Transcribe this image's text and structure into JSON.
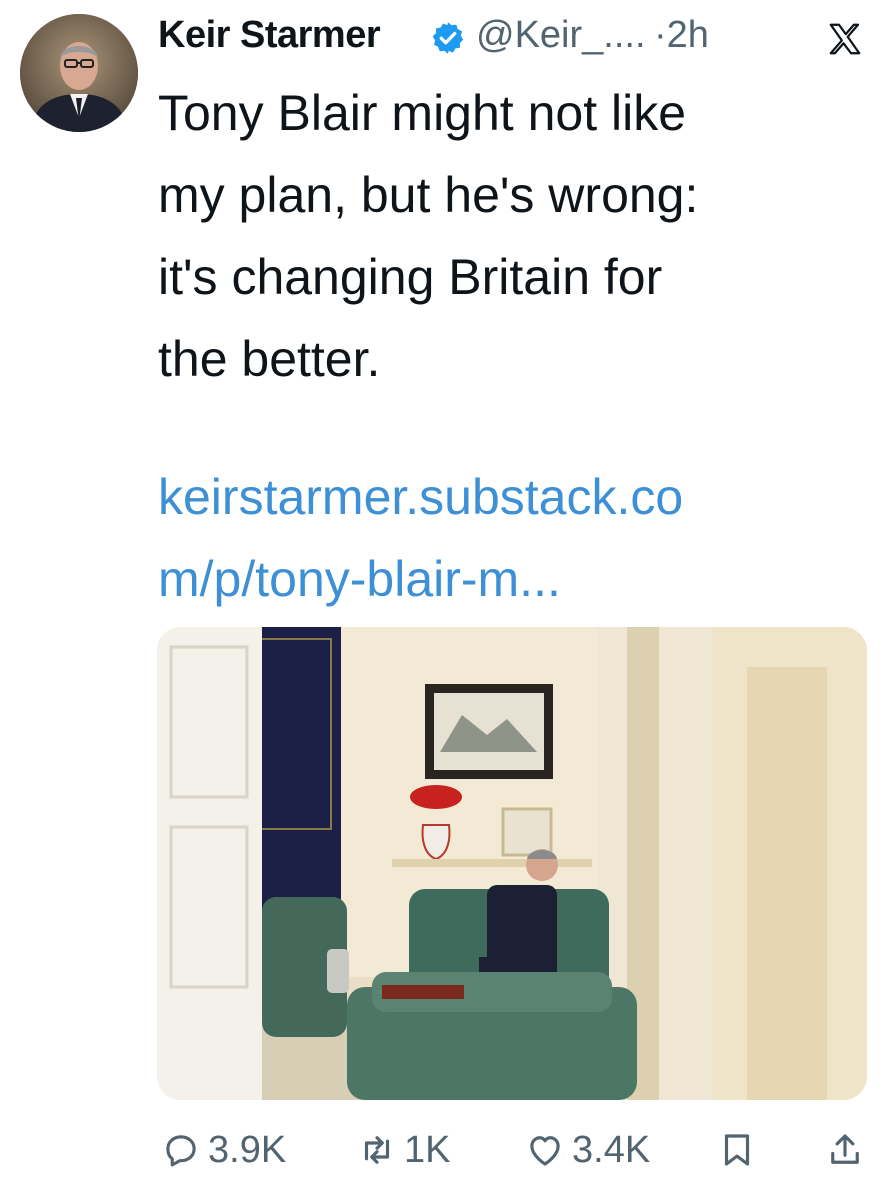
{
  "tweet": {
    "author_name": "Keir Starmer",
    "handle": "@Keir_....",
    "separator_time": "·2h",
    "body": "Tony Blair might not like\nmy plan, but he's wrong:\nit's changing Britain for\nthe better.",
    "link": "keirstarmer.substack.co\nm/p/tony-blair-m..."
  },
  "icons": {
    "verified": "verified-badge-icon",
    "platform": "x-logo-icon",
    "reply": "reply-icon",
    "repost": "repost-icon",
    "like": "heart-icon",
    "bookmark": "bookmark-icon",
    "share": "share-icon"
  },
  "actions": {
    "replies": "3.9K",
    "reposts": "1K",
    "likes": "3.4K"
  },
  "colors": {
    "link": "#3d8fd6",
    "muted": "#536471",
    "text": "#0f1419"
  }
}
